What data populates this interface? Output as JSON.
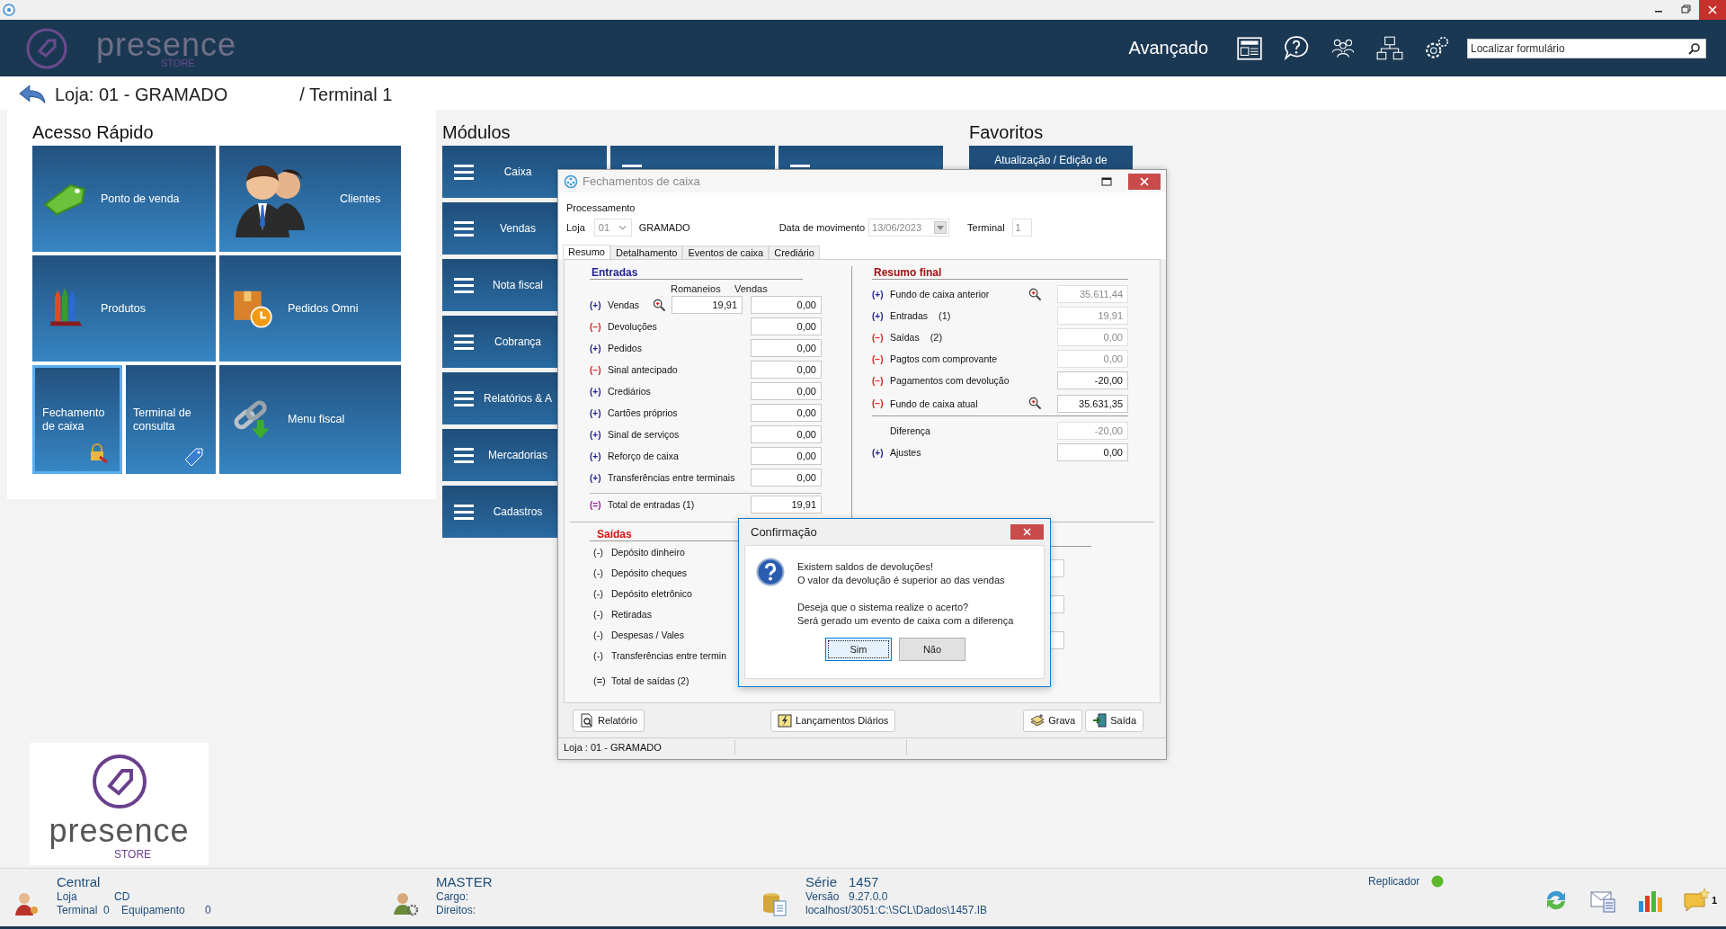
{
  "header": {
    "logo": {
      "name": "presence",
      "tagline": "STORE"
    },
    "mode": "Avançado",
    "search": {
      "placeholder": "Localizar formulário"
    }
  },
  "breadcrumb": {
    "store": "Loja: 01 - GRAMADO",
    "terminal": "/ Terminal 1"
  },
  "quick_access": {
    "title": "Acesso Rápido",
    "tiles": [
      {
        "label": "Ponto de venda",
        "kind": "sale",
        "selected": false
      },
      {
        "label": "Clientes",
        "kind": "people",
        "selected": false
      },
      {
        "label": "Produtos",
        "kind": "crayons",
        "selected": false
      },
      {
        "label": "Pedidos Omni",
        "kind": "box",
        "selected": false
      },
      {
        "label": "Fechamento de caixa",
        "kind": "lock",
        "selected": true
      },
      {
        "label": "Terminal de consulta",
        "kind": "tag",
        "selected": false
      },
      {
        "label": "Menu fiscal",
        "kind": "chain",
        "selected": false
      }
    ]
  },
  "modules": {
    "title": "Módulos",
    "items": [
      {
        "label": "Caixa"
      },
      {
        "label": "Vendas"
      },
      {
        "label": "Nota fiscal"
      },
      {
        "label": "Cobrança"
      },
      {
        "label": "Relatórios & A"
      },
      {
        "label": "Mercadorias"
      },
      {
        "label": "Cadastros"
      }
    ]
  },
  "favorites": {
    "title": "Favoritos",
    "items": [
      {
        "label": "Atualização / Edição de"
      }
    ]
  },
  "brand_card": {
    "name": "presence",
    "tagline": "STORE"
  },
  "closing_window": {
    "title": "Fechamentos de caixa",
    "section": "Processamento",
    "store_label": "Loja",
    "store_code": "01",
    "store_name": "GRAMADO",
    "date_label": "Data de movimento",
    "date": "13/06/2023",
    "terminal_label": "Terminal",
    "terminal": "1",
    "tabs": [
      {
        "label": "Resumo",
        "selected": true
      },
      {
        "label": "Detalhamento",
        "selected": false
      },
      {
        "label": "Eventos de caixa",
        "selected": false
      },
      {
        "label": "Crediário",
        "selected": false
      }
    ],
    "entradas": {
      "title": "Entradas",
      "col_romaneios": "Romaneios",
      "col_vendas": "Vendas",
      "rows": [
        {
          "sign": "(+)",
          "kind": "plus",
          "label": "Vendas",
          "romaneios": "19,91",
          "vendas": "0,00",
          "lookup": true
        },
        {
          "sign": "(−)",
          "kind": "minus",
          "label": "Devoluções",
          "vendas": "0,00",
          "lookup": false
        },
        {
          "sign": "(+)",
          "kind": "plus",
          "label": "Pedidos",
          "vendas": "0,00",
          "lookup": false
        },
        {
          "sign": "(−)",
          "kind": "minus",
          "label": "Sinal antecipado",
          "vendas": "0,00",
          "lookup": false
        },
        {
          "sign": "(+)",
          "kind": "plus",
          "label": "Crediários",
          "vendas": "0,00",
          "lookup": false
        },
        {
          "sign": "(+)",
          "kind": "plus",
          "label": "Cartões próprios",
          "vendas": "0,00",
          "lookup": false
        },
        {
          "sign": "(+)",
          "kind": "plus",
          "label": "Sinal de serviços",
          "vendas": "0,00",
          "lookup": false
        },
        {
          "sign": "(+)",
          "kind": "plus",
          "label": "Reforço de caixa",
          "vendas": "0,00",
          "lookup": false
        },
        {
          "sign": "(+)",
          "kind": "plus",
          "label": "Transferências entre terminais",
          "vendas": "0,00",
          "lookup": false
        }
      ],
      "total": {
        "sign": "(=)",
        "kind": "total",
        "label": "Total de entradas (1)",
        "value": "19,91"
      }
    },
    "saidas": {
      "title": "Saídas",
      "rows": [
        {
          "sign": "(-)",
          "label": "Depósito dinheiro"
        },
        {
          "sign": "(-)",
          "label": "Depósito cheques"
        },
        {
          "sign": "(-)",
          "label": "Depósito eletrônico"
        },
        {
          "sign": "(-)",
          "label": "Retiradas"
        },
        {
          "sign": "(-)",
          "label": "Despesas / Vales"
        },
        {
          "sign": "(-)",
          "label": "Transferências entre termin"
        }
      ],
      "total": {
        "sign": "(=)",
        "label": "Total de saídas (2)"
      }
    },
    "resumo_final": {
      "title": "Resumo final",
      "rows": [
        {
          "sign": "(+)",
          "kind": "plus",
          "label": "Fundo de caixa anterior",
          "value": "35.611,44",
          "disabled": true,
          "lookup": true
        },
        {
          "sign": "(+)",
          "kind": "plus",
          "label": "Entradas",
          "ref": "(1)",
          "value": "19,91",
          "disabled": true,
          "lookup": false
        },
        {
          "sign": "(−)",
          "kind": "minus",
          "label": "Saídas",
          "ref": "(2)",
          "value": "0,00",
          "disabled": true,
          "lookup": false
        },
        {
          "sign": "(−)",
          "kind": "minus",
          "label": "Pagtos com comprovante",
          "value": "0,00",
          "disabled": true,
          "lookup": false
        },
        {
          "sign": "(−)",
          "kind": "minus",
          "label": "Pagamentos com devolução",
          "value": "-20,00",
          "disabled": false,
          "lookup": false
        },
        {
          "sign": "(−)",
          "kind": "minus",
          "label": "Fundo de caixa atual",
          "value": "35.631,35",
          "disabled": false,
          "lookup": true,
          "rule_after": true
        },
        {
          "kind": "none",
          "label": "Diferença",
          "value": "-20,00",
          "disabled": true,
          "lookup": false
        },
        {
          "sign": "(+)",
          "kind": "plus",
          "label": "Ajustes",
          "value": "0,00",
          "disabled": false,
          "lookup": false
        }
      ]
    },
    "buttons": [
      {
        "label": "Relatório",
        "kind": "report"
      },
      {
        "label": "Lançamentos Diários",
        "kind": "daily"
      },
      {
        "label": "Grava",
        "kind": "save"
      },
      {
        "label": "Saída",
        "kind": "exit"
      }
    ],
    "status": "Loja : 01 - GRAMADO"
  },
  "confirm_dialog": {
    "title": "Confirmação",
    "paragraphs": [
      [
        "Existem saldos de devoluções!",
        "O valor da devolução é superior ao das vendas"
      ],
      [
        "Deseja que o sistema realize o acerto?",
        "Será gerado um evento de caixa com a diferença"
      ]
    ],
    "buttons": [
      {
        "label": "Sim",
        "default": true
      },
      {
        "label": "Não",
        "default": false
      }
    ]
  },
  "status_bar": {
    "central": {
      "title": "Central",
      "store_label": "Loja",
      "store": "CD",
      "terminal_label": "Terminal",
      "terminal": "0",
      "equipment_label": "Equipamento",
      "equipment": "0"
    },
    "user": {
      "name": "MASTER",
      "role_label": "Cargo:",
      "rights_label": "Direitos:"
    },
    "db": {
      "series_label": "Série",
      "series": "1457",
      "version_label": "Versão",
      "version": "9.27.0.0",
      "path": "localhost/3051:C:\\SCL\\Dados\\1457.IB"
    },
    "replicator": {
      "label": "Replicador",
      "active": true
    },
    "notifications": "1"
  }
}
